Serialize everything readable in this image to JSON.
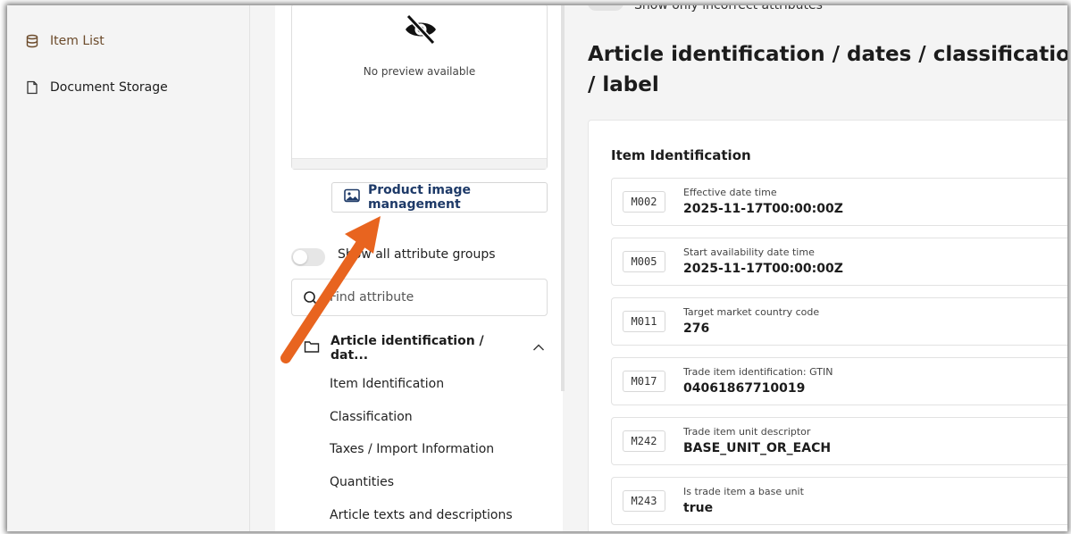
{
  "sidebar": {
    "items": [
      {
        "label": "Item List",
        "icon": "database-icon"
      },
      {
        "label": "Document Storage",
        "icon": "document-icon"
      }
    ]
  },
  "preview": {
    "text": "No preview available",
    "icon": "eye-slash-icon"
  },
  "image_management": {
    "label": "Product image management",
    "icon": "image-icon"
  },
  "attribute_groups_toggle": {
    "label": "Show all attribute groups",
    "checked": false
  },
  "find_attribute": {
    "placeholder": "Find attribute"
  },
  "attribute_group": {
    "label": "Article identification / dat...",
    "expanded": true,
    "items": [
      "Item Identification",
      "Classification",
      "Taxes / Import Information",
      "Quantities",
      "Article texts and descriptions"
    ]
  },
  "header": {
    "toggle_label": "Show only incorrect attributes",
    "title": "Article identification / dates / classification / label"
  },
  "section": {
    "title": "Item Identification",
    "attributes": [
      {
        "code": "M002",
        "label": "Effective date time",
        "value": "2025-11-17T00:00:00Z"
      },
      {
        "code": "M005",
        "label": "Start availability date time",
        "value": "2025-11-17T00:00:00Z"
      },
      {
        "code": "M011",
        "label": "Target market country code",
        "value": "276"
      },
      {
        "code": "M017",
        "label": "Trade item identification: GTIN",
        "value": "04061867710019"
      },
      {
        "code": "M242",
        "label": "Trade item unit descriptor",
        "value": "BASE_UNIT_OR_EACH"
      },
      {
        "code": "M243",
        "label": "Is trade item a base unit",
        "value": "true"
      }
    ]
  },
  "colors": {
    "accent": "#1e3a68",
    "annotation_arrow": "#e8641f",
    "background": "#f4f4f4"
  }
}
